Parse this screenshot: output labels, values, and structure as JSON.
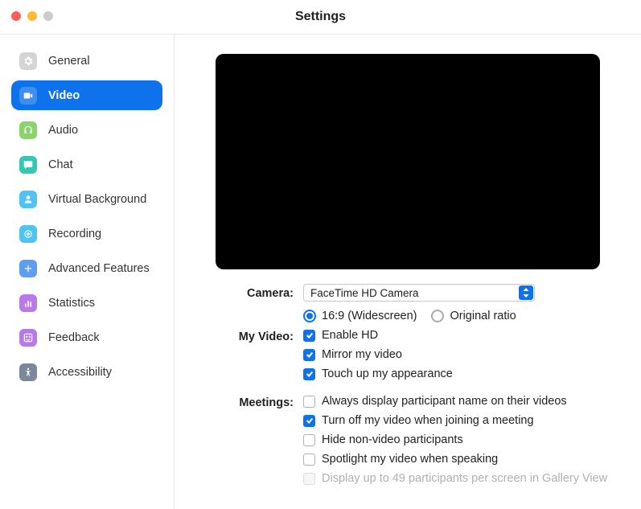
{
  "window": {
    "title": "Settings"
  },
  "sidebar": {
    "items": [
      {
        "label": "General"
      },
      {
        "label": "Video"
      },
      {
        "label": "Audio"
      },
      {
        "label": "Chat"
      },
      {
        "label": "Virtual Background"
      },
      {
        "label": "Recording"
      },
      {
        "label": "Advanced Features"
      },
      {
        "label": "Statistics"
      },
      {
        "label": "Feedback"
      },
      {
        "label": "Accessibility"
      }
    ]
  },
  "settings": {
    "camera_label": "Camera:",
    "camera_selected": "FaceTime HD Camera",
    "aspect_ratio": {
      "widescreen": "16:9 (Widescreen)",
      "original": "Original ratio"
    },
    "my_video_label": "My Video:",
    "my_video": {
      "enable_hd": "Enable HD",
      "mirror": "Mirror my video",
      "touch_up": "Touch up my appearance"
    },
    "meetings_label": "Meetings:",
    "meetings": {
      "display_name": "Always display participant name on their videos",
      "turn_off_video": "Turn off my video when joining a meeting",
      "hide_nonvideo": "Hide non-video participants",
      "spotlight": "Spotlight my video when speaking",
      "gallery_49": "Display up to 49 participants per screen in Gallery View"
    }
  }
}
